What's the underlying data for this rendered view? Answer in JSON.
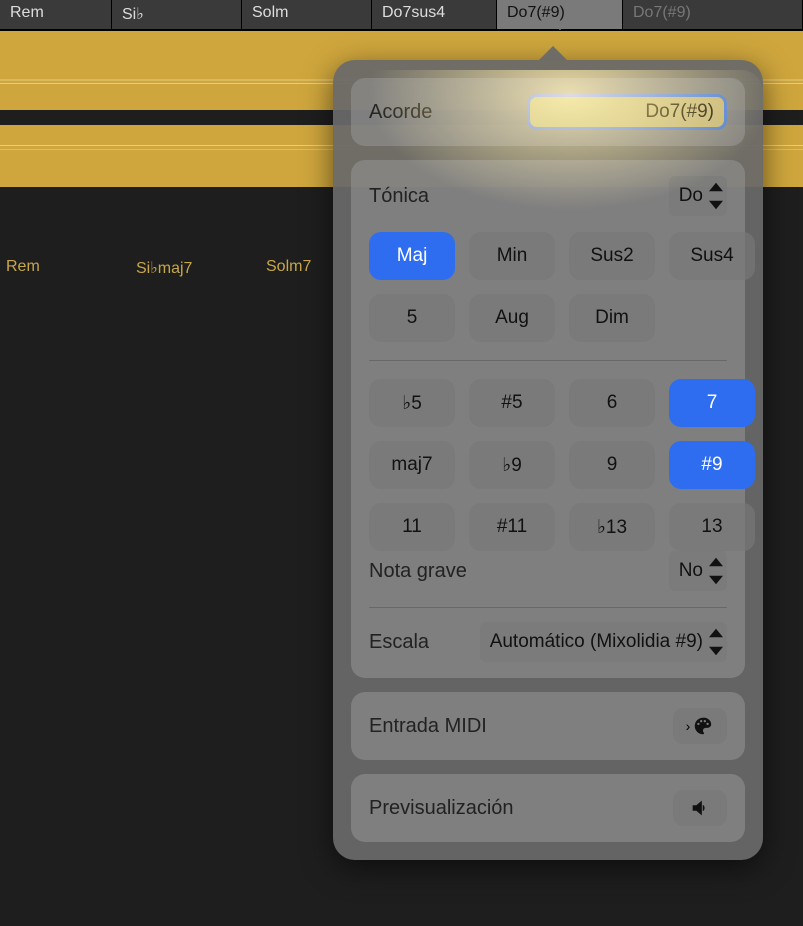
{
  "chord_tabs": [
    {
      "label": "Rem",
      "active": false
    },
    {
      "label": "Si♭",
      "active": false
    },
    {
      "label": "Solm",
      "active": false
    },
    {
      "label": "Do7sus4",
      "active": false
    },
    {
      "label": "Do7(#9)",
      "active": true
    },
    {
      "label": "Do7(#9)",
      "active": false,
      "dim": true
    }
  ],
  "sub_labels": [
    "Rem",
    "Si♭maj7",
    "Solm7"
  ],
  "popover": {
    "acorde_label": "Acorde",
    "acorde_value": "Do7(#9)",
    "tonica_label": "Tónica",
    "tonica_value": "Do",
    "qualities": [
      {
        "label": "Maj",
        "selected": true
      },
      {
        "label": "Min"
      },
      {
        "label": "Sus2"
      },
      {
        "label": "Sus4"
      },
      {
        "label": "5"
      },
      {
        "label": "Aug"
      },
      {
        "label": "Dim"
      }
    ],
    "extensions": [
      {
        "label": "♭5"
      },
      {
        "label": "#5"
      },
      {
        "label": "6"
      },
      {
        "label": "7",
        "selected": true
      },
      {
        "label": "maj7"
      },
      {
        "label": "♭9"
      },
      {
        "label": "9"
      },
      {
        "label": "#9",
        "selected": true
      },
      {
        "label": "11"
      },
      {
        "label": "#11"
      },
      {
        "label": "♭13"
      },
      {
        "label": "13"
      }
    ],
    "bass_label": "Nota grave",
    "bass_value": "No",
    "scale_label": "Escala",
    "scale_value": "Automático (Mixolidia #9)",
    "midi_label": "Entrada MIDI",
    "preview_label": "Previsualización"
  }
}
